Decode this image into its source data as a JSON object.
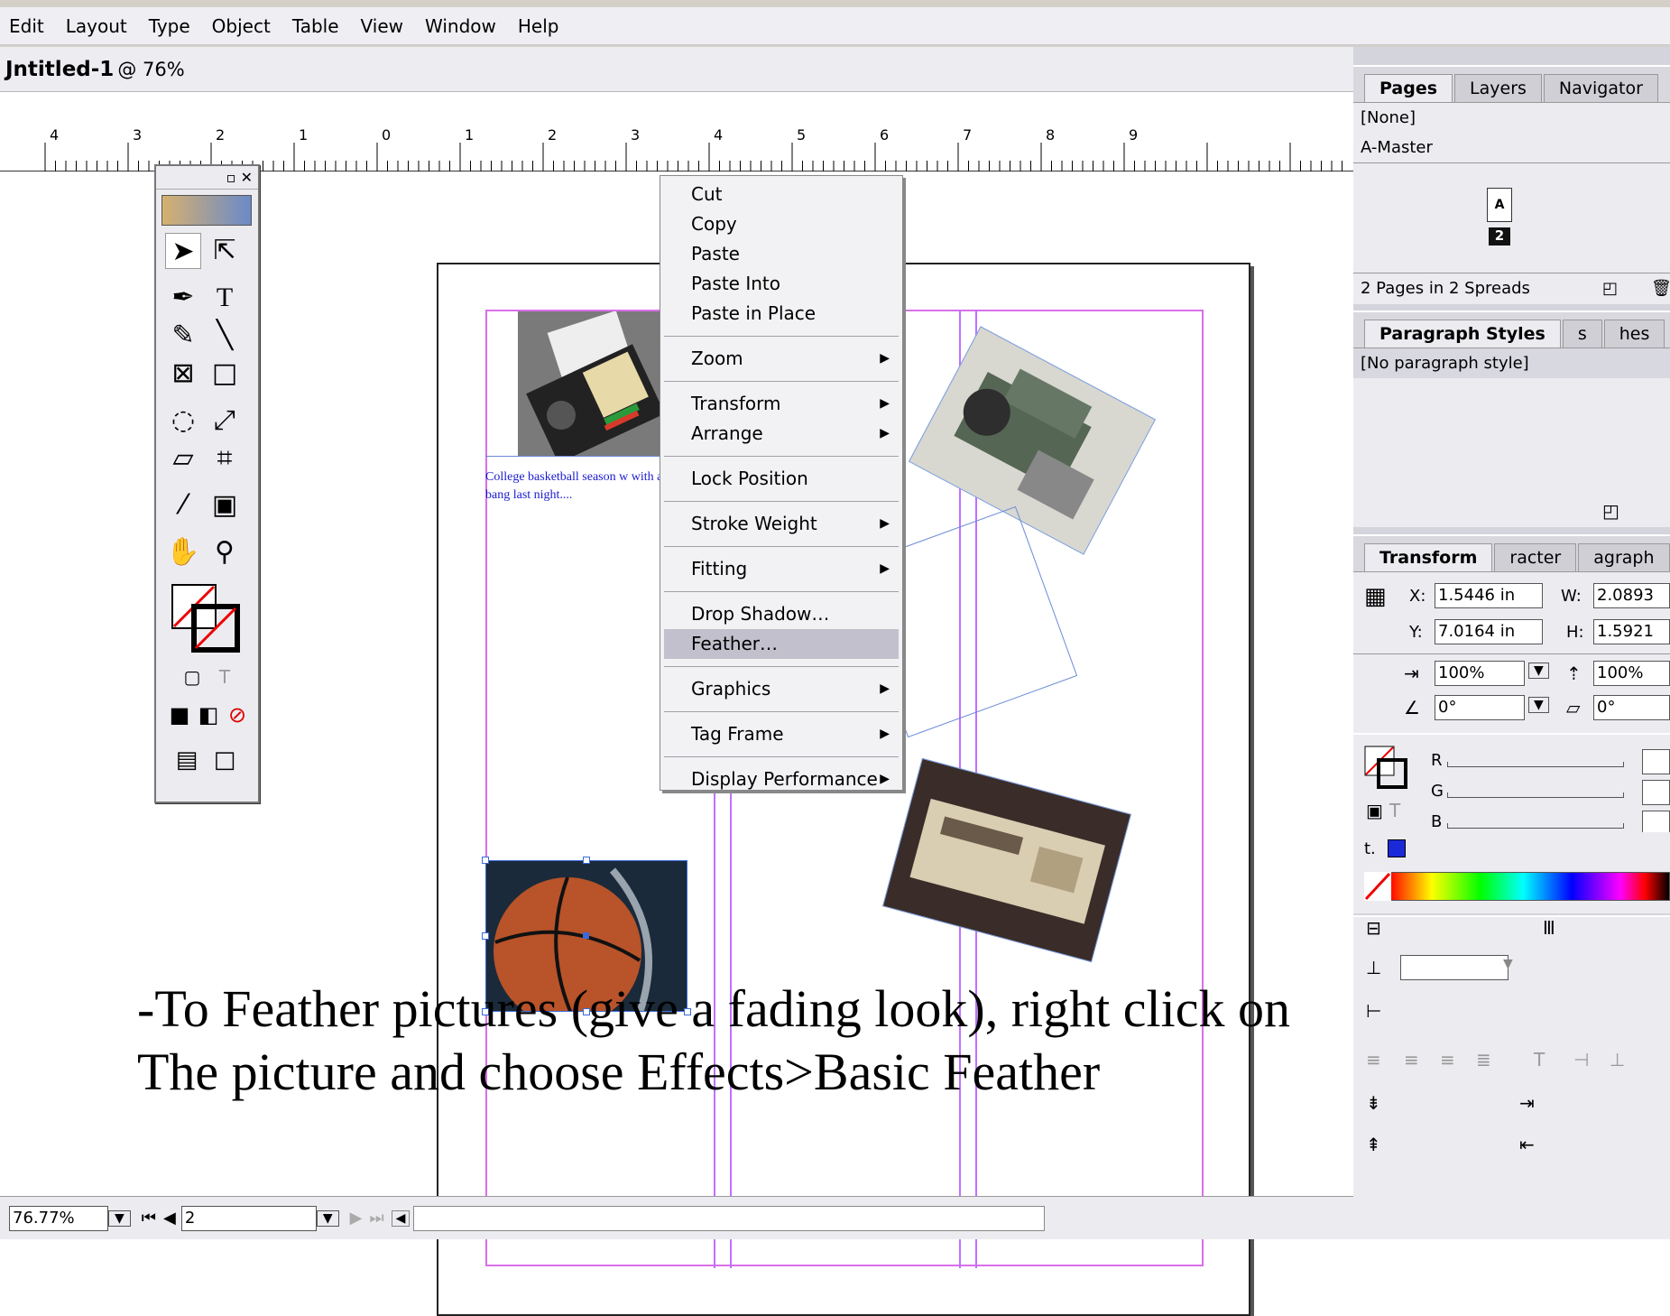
{
  "menubar": {
    "items": [
      "Edit",
      "Layout",
      "Type",
      "Object",
      "Table",
      "View",
      "Window",
      "Help"
    ]
  },
  "document": {
    "title": "Jntitled-1",
    "zoom": "@ 76%",
    "ruler_numbers": [
      "4",
      "3",
      "2",
      "1",
      "0",
      "1",
      "2",
      "3",
      "4",
      "5",
      "6",
      "7",
      "8",
      "9"
    ],
    "body_text": "College basketball season w with a bang last night...."
  },
  "context_menu": {
    "groups": [
      [
        "Cut",
        "Copy",
        "Paste",
        "Paste Into",
        "Paste in Place"
      ],
      [
        "Zoom"
      ],
      [
        "Transform",
        "Arrange"
      ],
      [
        "Lock Position"
      ],
      [
        "Stroke Weight"
      ],
      [
        "Fitting"
      ],
      [
        "Drop Shadow…",
        "Feather…"
      ],
      [
        "Graphics"
      ],
      [
        "Tag Frame"
      ],
      [
        "Display Performance"
      ]
    ],
    "submenu_items": [
      "Zoom",
      "Transform",
      "Arrange",
      "Stroke Weight",
      "Fitting",
      "Graphics",
      "Tag Frame",
      "Display Performance"
    ],
    "selected": "Feather…"
  },
  "pages_panel": {
    "tabs": [
      "Pages",
      "Layers",
      "Navigator"
    ],
    "none_label": "[None]",
    "master_label": "A-Master",
    "page_letter": "A",
    "page_number": "2",
    "footer": "2 Pages in 2 Spreads"
  },
  "paragraph_panel": {
    "tabs": [
      "Paragraph Styles",
      "s",
      "hes"
    ],
    "item": "[No paragraph style]"
  },
  "transform_panel": {
    "tabs": [
      "Transform",
      "racter",
      "agraph"
    ],
    "x_label": "X:",
    "x_value": "1.5446 in",
    "y_label": "Y:",
    "y_value": "7.0164 in",
    "w_label": "W:",
    "w_value": "2.0893 in",
    "h_label": "H:",
    "h_value": "1.5921 in",
    "scale_x": "100%",
    "scale_y": "100%",
    "rotation": "0°",
    "shear": "0°"
  },
  "color_panel": {
    "channels": [
      "R",
      "G",
      "B"
    ],
    "tint_label": "t."
  },
  "status": {
    "zoom": "76.77%",
    "page": "2"
  },
  "caption": {
    "line1": "-To Feather pictures (give a fading look), right click on",
    "line2": "The picture and choose Effects>Basic Feather"
  },
  "colors": {
    "guide": "#c070ff",
    "selection": "#c2c0cc",
    "accent": "#0000ff"
  }
}
